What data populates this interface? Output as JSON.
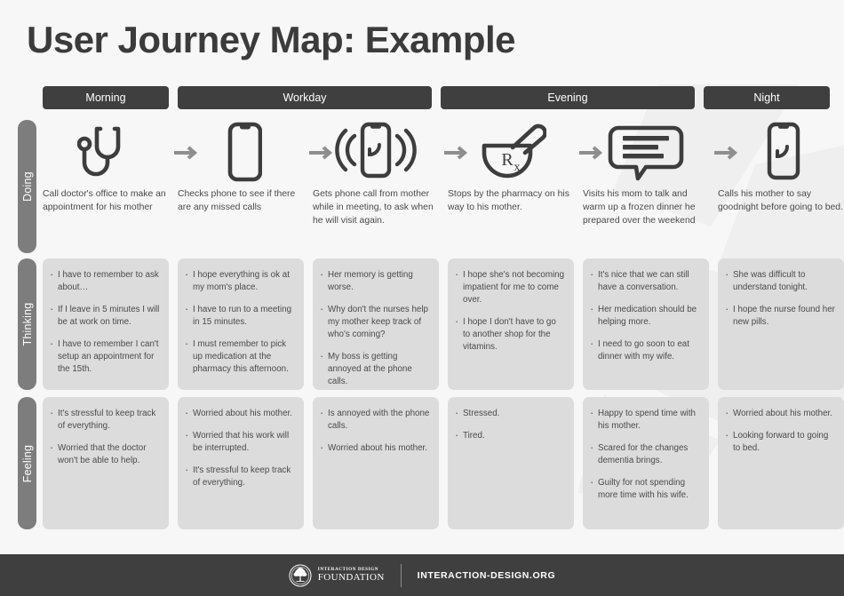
{
  "page": {
    "title": "User Journey Map: Example",
    "background_color": "#f7f7f7",
    "accent_dark": "#3f3f3f",
    "label_gray": "#7d7d7d",
    "card_gray": "#dcdcdc"
  },
  "phases": [
    {
      "label": "Morning",
      "span": 1
    },
    {
      "label": "Workday",
      "span": 2
    },
    {
      "label": "Evening",
      "span": 2
    },
    {
      "label": "Night",
      "span": 1
    }
  ],
  "rows": [
    {
      "label": "Doing"
    },
    {
      "label": "Thinking"
    },
    {
      "label": "Feeling"
    }
  ],
  "doing": [
    {
      "icon": "stethoscope-icon",
      "text": "Call doctor's office to make an appointment for his mother"
    },
    {
      "icon": "smartphone-icon",
      "text": "Checks phone to see if there are any missed calls"
    },
    {
      "icon": "ringing-phone-icon",
      "text": "Gets phone call from mother while in meeting, to ask when he will visit again."
    },
    {
      "icon": "mortar-pestle-rx-icon",
      "text": "Stops by the pharmacy on his way to his mother."
    },
    {
      "icon": "speech-bubble-icon",
      "text": "Visits his mom to talk and warm up a frozen dinner he prepared over the weekend"
    },
    {
      "icon": "phone-call-icon",
      "text": "Calls his mother to say goodnight before going to bed."
    }
  ],
  "arrow_icon": "arrow-right-icon",
  "thinking": [
    [
      "I have to remember to ask about…",
      "If I leave in 5 minutes I will be at work on time.",
      "I have to remember I can't setup an appointment for the 15th."
    ],
    [
      "I hope everything is ok at my mom's place.",
      "I have to run to a meeting in 15 minutes.",
      "I must remember to pick up medication at the pharmacy this afternoon."
    ],
    [
      "Her memory is getting worse.",
      "Why don't the nurses help my mother keep track of who's coming?",
      "My boss is getting annoyed at the phone calls."
    ],
    [
      "I hope she's not becoming impatient for me to come over.",
      "I hope I don't have to go to another shop for the vitamins."
    ],
    [
      "It's nice that we can still have a conversation.",
      "Her medication should be helping more.",
      "I need to go soon to eat dinner with my wife."
    ],
    [
      "She was difficult to understand tonight.",
      "I hope the nurse found her new pills."
    ]
  ],
  "feeling": [
    [
      "It's stressful to keep track of everything.",
      "Worried that the doctor won't be able to help."
    ],
    [
      "Worried about his mother.",
      "Worried that his work will be interrupted.",
      "It's stressful to keep track of everything."
    ],
    [
      "Is annoyed with the phone calls.",
      "Worried about his mother."
    ],
    [
      "Stressed.",
      "Tired."
    ],
    [
      "Happy to spend time with his mother.",
      "Scared for the changes dementia brings.",
      "Guilty for not spending more time with his wife."
    ],
    [
      "Worried about his mother.",
      "Looking forward to going to bed."
    ]
  ],
  "footer": {
    "logo_icon": "idf-tree-seal-icon",
    "brand_line1": "INTERACTION DESIGN",
    "brand_line2": "FOUNDATION",
    "url": "INTERACTION-DESIGN.ORG"
  }
}
